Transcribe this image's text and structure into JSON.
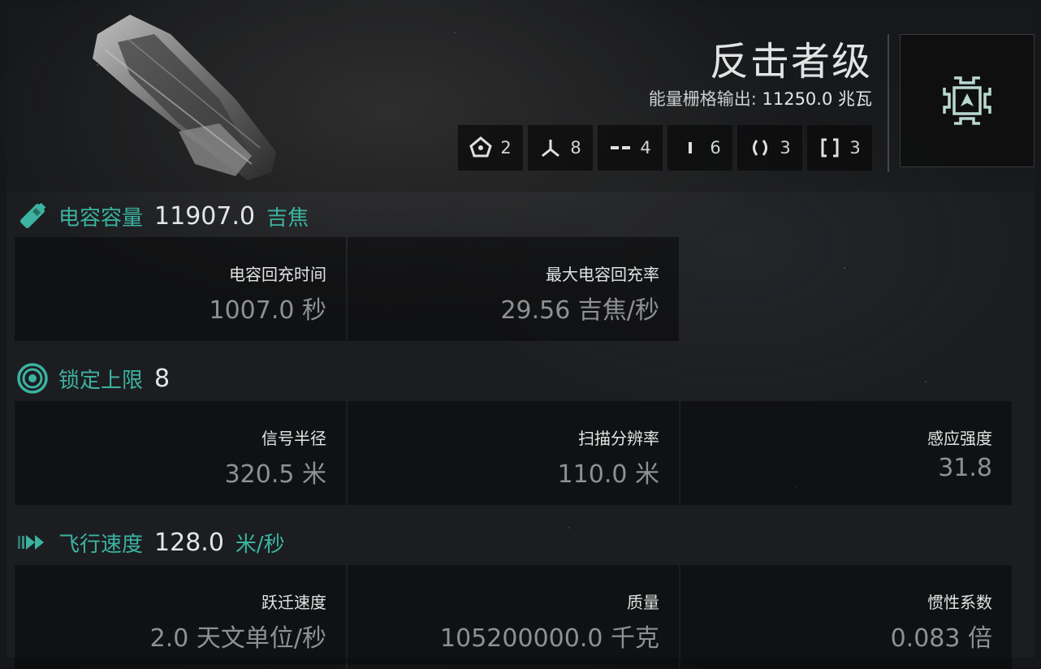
{
  "ship": {
    "name": "反击者级",
    "power_label": "能量栅格输出:",
    "power_value": "11250.0 兆瓦"
  },
  "slots": [
    {
      "icon": "high-slot-icon",
      "count": "2"
    },
    {
      "icon": "turret-hardpoint-icon",
      "count": "8"
    },
    {
      "icon": "mid-slot-icon",
      "count": "4"
    },
    {
      "icon": "low-slot-icon",
      "count": "6"
    },
    {
      "icon": "rig-slot-icon",
      "count": "3"
    },
    {
      "icon": "subsystem-slot-icon",
      "count": "3"
    }
  ],
  "role": {
    "icon": "ship-role-icon"
  },
  "capacitor": {
    "label": "电容容量",
    "value": "11907.0",
    "unit": "吉焦",
    "stats": [
      {
        "label": "电容回充时间",
        "value": "1007.0 秒"
      },
      {
        "label": "最大电容回充率",
        "value": "29.56 吉焦/秒"
      }
    ]
  },
  "targeting": {
    "label": "锁定上限",
    "value": "8",
    "stats": [
      {
        "label": "信号半径",
        "value": "320.5 米"
      },
      {
        "label": "扫描分辨率",
        "value": "110.0 米"
      },
      {
        "label": "感应强度",
        "value": "31.8"
      }
    ]
  },
  "navigation": {
    "label": "飞行速度",
    "value": "128.0",
    "unit": "米/秒",
    "stats": [
      {
        "label": "跃迁速度",
        "value": "2.0 天文单位/秒"
      },
      {
        "label": "质量",
        "value": "105200000.0 千克"
      },
      {
        "label": "惯性系数",
        "value": "0.083 倍"
      }
    ]
  },
  "colors": {
    "accent": "#3bb3a0",
    "value_dim": "#8d9191",
    "text": "#e1e4e4"
  }
}
